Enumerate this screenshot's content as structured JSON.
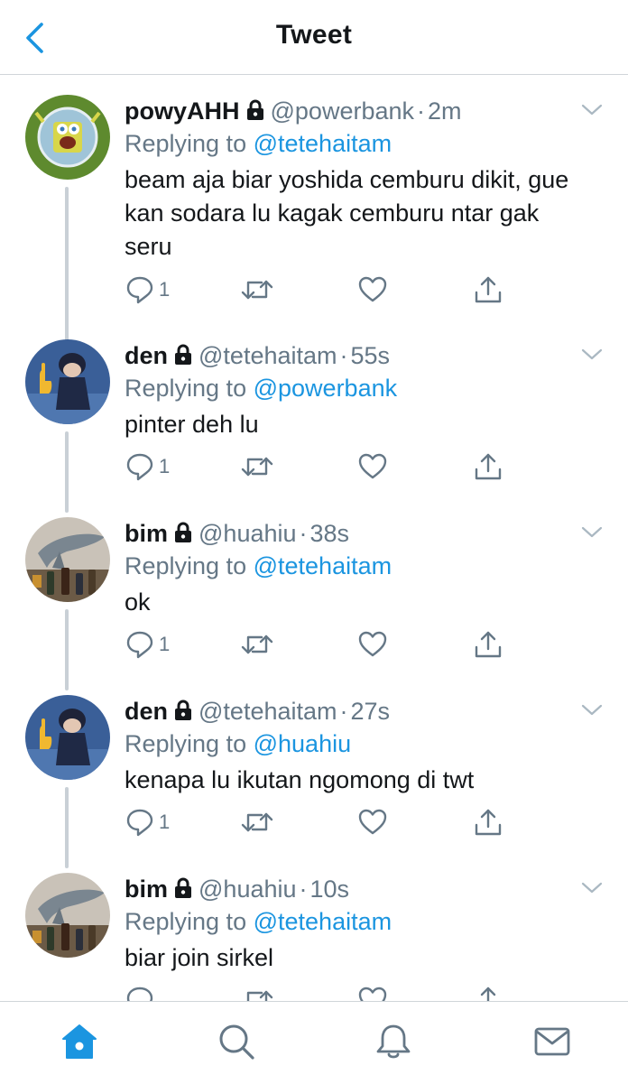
{
  "header": {
    "title": "Tweet"
  },
  "colors": {
    "accent": "#1b95e0",
    "muted": "#657786",
    "text": "#14171a",
    "thread": "#c9d0d6"
  },
  "tweets": [
    {
      "name": "powyAHH",
      "handle": "@powerbank",
      "dot": "·",
      "time": "2m",
      "replying_prefix": "Replying to",
      "replying_to": "@tetehaitam",
      "lines": [
        "beam aja biar yoshida cemburu dikit, gue",
        "kan sodara lu kagak cemburu ntar gak",
        "seru"
      ],
      "reply_count": "1",
      "avatar": "spongebob-avatar"
    },
    {
      "name": "den",
      "handle": "@tetehaitam",
      "dot": "·",
      "time": "55s",
      "replying_prefix": "Replying to",
      "replying_to": "@powerbank",
      "lines": [
        "pinter deh lu"
      ],
      "reply_count": "1",
      "avatar": "anime-figure-avatar"
    },
    {
      "name": "bim",
      "handle": "@huahiu",
      "dot": "·",
      "time": "38s",
      "replying_prefix": "Replying to",
      "replying_to": "@tetehaitam",
      "lines": [
        "ok"
      ],
      "reply_count": "1",
      "avatar": "shark-bottles-avatar"
    },
    {
      "name": "den",
      "handle": "@tetehaitam",
      "dot": "·",
      "time": "27s",
      "replying_prefix": "Replying to",
      "replying_to": "@huahiu",
      "lines": [
        "kenapa lu ikutan ngomong di twt"
      ],
      "reply_count": "1",
      "avatar": "anime-figure-avatar"
    },
    {
      "name": "bim",
      "handle": "@huahiu",
      "dot": "·",
      "time": "10s",
      "replying_prefix": "Replying to",
      "replying_to": "@tetehaitam",
      "lines": [
        "biar join sirkel"
      ],
      "reply_count": "",
      "avatar": "shark-bottles-avatar"
    }
  ],
  "tabbar": {
    "items": [
      "home-icon",
      "search-icon",
      "notifications-icon",
      "messages-icon"
    ]
  }
}
